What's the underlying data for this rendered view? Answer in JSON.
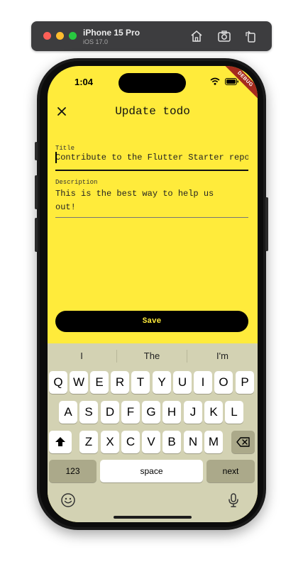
{
  "simulator": {
    "device_name": "iPhone 15 Pro",
    "os_version": "iOS 17.0",
    "tools": [
      "home-icon",
      "screenshot-icon",
      "rotate-icon"
    ]
  },
  "status_bar": {
    "time": "1:04",
    "icons": [
      "wifi-icon",
      "battery-icon"
    ]
  },
  "debug_banner": "DEBUG",
  "app_bar": {
    "title": "Update todo",
    "close_icon": "close-icon"
  },
  "form": {
    "title_label": "Title",
    "title_value": "Contribute to the Flutter Starter repo",
    "description_label": "Description",
    "description_value": "This is the best way to help us\nout!",
    "save_label": "Save"
  },
  "keyboard": {
    "suggestions": [
      "I",
      "The",
      "I'm"
    ],
    "row1": [
      "Q",
      "W",
      "E",
      "R",
      "T",
      "Y",
      "U",
      "I",
      "O",
      "P"
    ],
    "row2": [
      "A",
      "S",
      "D",
      "F",
      "G",
      "H",
      "J",
      "K",
      "L"
    ],
    "row3": [
      "Z",
      "X",
      "C",
      "V",
      "B",
      "N",
      "M"
    ],
    "numbers_label": "123",
    "space_label": "space",
    "return_label": "next",
    "icons": [
      "shift-icon",
      "backspace-icon",
      "emoji-icon",
      "microphone-icon"
    ]
  },
  "colors": {
    "app_background": "#ffeb3b",
    "button_background": "#000000",
    "button_text": "#ffeb3b",
    "keyboard_background": "#d3d2b3"
  }
}
